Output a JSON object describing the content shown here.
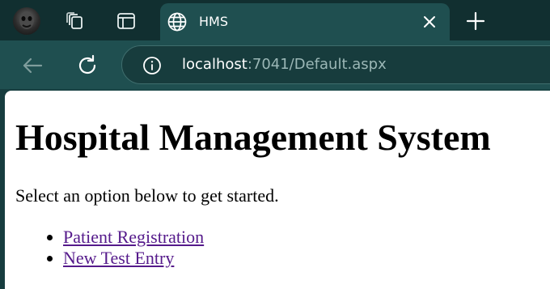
{
  "browser": {
    "tab": {
      "title": "HMS"
    },
    "address": {
      "host": "localhost",
      "rest": ":7041/Default.aspx"
    },
    "colors": {
      "frame": "#112f30",
      "toolbar": "#1f4f50",
      "link_visited": "#551a8b"
    },
    "icons": [
      "avatar",
      "workspaces-icon",
      "tab-actions-icon",
      "globe-icon",
      "close-icon",
      "plus-icon",
      "back-icon",
      "reload-icon",
      "info-icon"
    ]
  },
  "page": {
    "heading": "Hospital Management System",
    "intro": "Select an option below to get started.",
    "links": [
      {
        "label": "Patient Registration"
      },
      {
        "label": "New Test Entry"
      }
    ]
  }
}
